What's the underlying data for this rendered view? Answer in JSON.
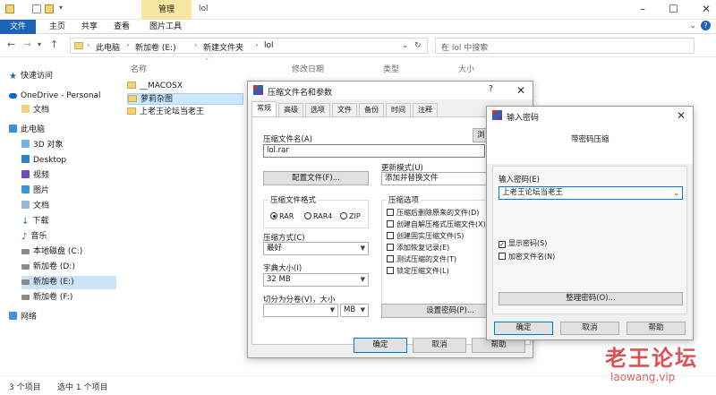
{
  "explorer": {
    "title_path": "lol",
    "context_tab": "管理",
    "ribbon_tabs": [
      "文件",
      "主页",
      "共享",
      "查看",
      "图片工具"
    ],
    "breadcrumbs": [
      "此电脑",
      "新加卷 (E:)",
      "新建文件夹",
      "lol"
    ],
    "search_placeholder": "在 lol 中搜索",
    "columns": [
      "名称",
      "修改日期",
      "类型",
      "大小"
    ],
    "files": [
      "__MACOSX",
      "萝莉杂图",
      "上老王论坛当老王"
    ],
    "status_count": "3 个项目",
    "status_selected": "选中 1 个项目"
  },
  "sidebar": {
    "items": [
      "快速访问",
      "OneDrive - Personal",
      "文档",
      "此电脑",
      "3D 对象",
      "Desktop",
      "视频",
      "图片",
      "文档",
      "下载",
      "音乐",
      "本地磁盘 (C:)",
      "新加卷 (D:)",
      "新加卷 (E:)",
      "新加卷 (F:)",
      "网络"
    ]
  },
  "archive_dialog": {
    "title": "压缩文件名和参数",
    "help_glyph": "?",
    "tabs": [
      "常规",
      "高级",
      "选项",
      "文件",
      "备份",
      "时间",
      "注释"
    ],
    "archive_name_label": "压缩文件名(A)",
    "archive_name_value": "lol.rar",
    "browse_button": "浏",
    "profiles_button": "配置文件(F)...",
    "update_mode_label": "更新模式(U)",
    "update_mode_value": "添加并替换文件",
    "format_label": "压缩文件格式",
    "formats": [
      "RAR",
      "RAR4",
      "ZIP"
    ],
    "options_label": "压缩选项",
    "options": [
      "压缩后删除原来的文件(D)",
      "创建自解压格式压缩文件(X)",
      "创建固实压缩文件(S)",
      "添加恢复记录(E)",
      "测试压缩的文件(T)",
      "锁定压缩文件(L)"
    ],
    "method_label": "压缩方式(C)",
    "method_value": "最好",
    "dict_label": "字典大小(I)",
    "dict_value": "32 MB",
    "split_label": "切分为分卷(V)，大小",
    "split_unit": "MB",
    "set_password_button": "设置密码(P)...",
    "ok": "确定",
    "cancel": "取消",
    "help": "帮助"
  },
  "password_dialog": {
    "title": "输入密码",
    "heading": "带密码压缩",
    "password_label": "输入密码(E)",
    "password_value": "上老王论坛当老王",
    "show_password": "显示密码(S)",
    "encrypt_names": "加密文件名(N)",
    "organize_button": "整理密码(O)...",
    "ok": "确定",
    "cancel": "取消",
    "help": "帮助"
  },
  "watermark": {
    "cn": "老王论坛",
    "en": "laowang.vip"
  },
  "colors": {
    "accent": "#1c64b8",
    "context_tab": "#f7e7a2",
    "selection": "#cce8ff",
    "watermark": "#d42020"
  }
}
